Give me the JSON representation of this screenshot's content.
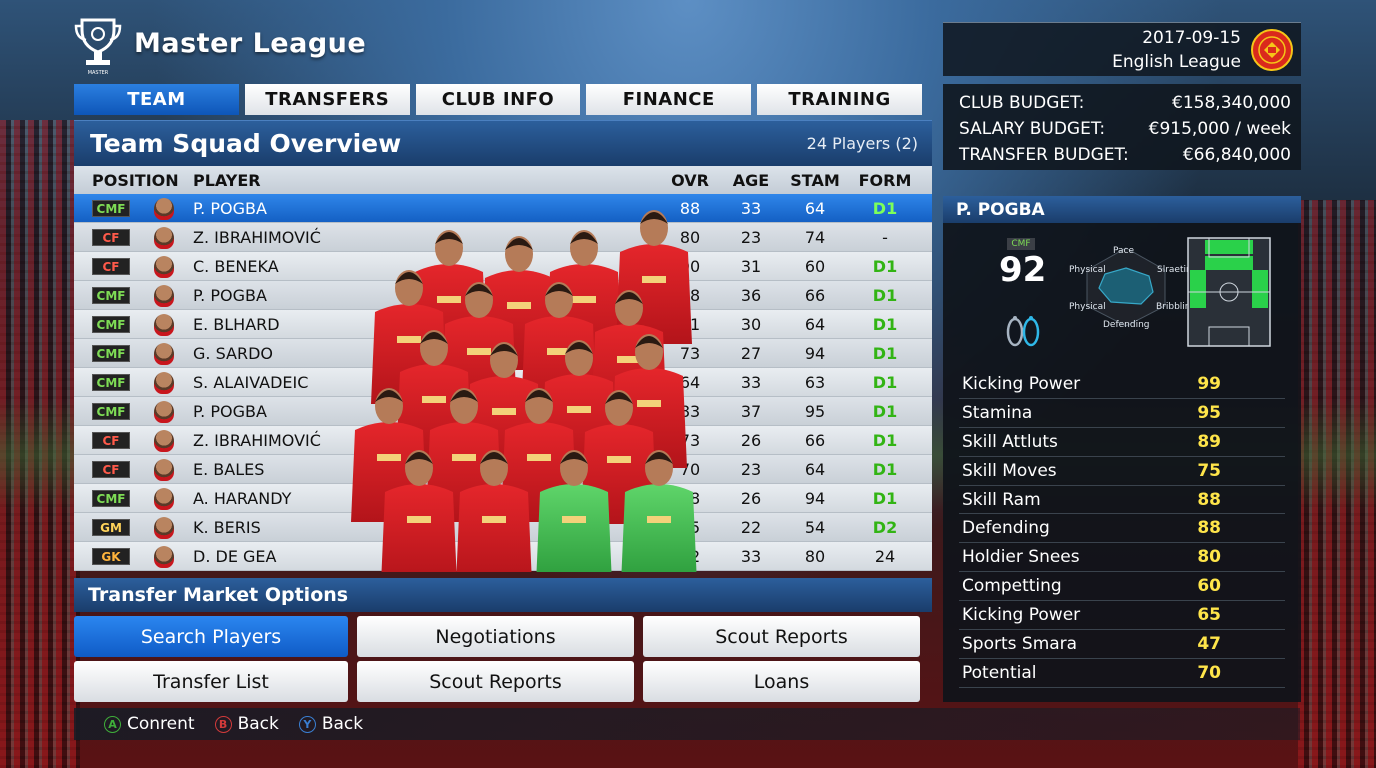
{
  "header": {
    "app_title": "Master League",
    "tabs": [
      "TEAM",
      "TRANSFERS",
      "CLUB INFO",
      "FINANCE",
      "TRAINING"
    ]
  },
  "club": {
    "date": "2017-09-15",
    "league": "English League"
  },
  "budget": [
    {
      "label": "CLUB BUDGET:",
      "value": "€158,340,000"
    },
    {
      "label": "SALARY BUDGET:",
      "value": "€915,000 / week"
    },
    {
      "label": "TRANSFER BUDGET:",
      "value": "€66,840,000"
    }
  ],
  "squad": {
    "title": "Team Squad Overview",
    "count": "24 Players (2)",
    "columns": {
      "position": "POSITION",
      "player": "PLAYER",
      "ovr": "OVR",
      "age": "AGE",
      "stam": "STAM",
      "form": "FORM"
    },
    "rows": [
      {
        "pos": "CMF",
        "name": "P. POGBA",
        "ovr": "88",
        "age": "33",
        "stam": "64",
        "form": "D1"
      },
      {
        "pos": "CF",
        "name": "Z. IBRAHIMOVIĆ",
        "ovr": "80",
        "age": "23",
        "stam": "74",
        "form": "-"
      },
      {
        "pos": "CF",
        "name": "C. BENEKA",
        "ovr": "90",
        "age": "31",
        "stam": "60",
        "form": "D1"
      },
      {
        "pos": "CMF",
        "name": "P. POGBA",
        "ovr": "88",
        "age": "36",
        "stam": "66",
        "form": "D1"
      },
      {
        "pos": "CMF",
        "name": "E. BLHARD",
        "ovr": "81",
        "age": "30",
        "stam": "64",
        "form": "D1"
      },
      {
        "pos": "CMF",
        "name": "G. SARDO",
        "ovr": "73",
        "age": "27",
        "stam": "94",
        "form": "D1"
      },
      {
        "pos": "CMF",
        "name": "S. ALAIVADEIC",
        "ovr": "64",
        "age": "33",
        "stam": "63",
        "form": "D1"
      },
      {
        "pos": "CMF",
        "name": "P. POGBA",
        "ovr": "83",
        "age": "37",
        "stam": "95",
        "form": "D1"
      },
      {
        "pos": "CF",
        "name": "Z. IBRAHIMOVIĆ",
        "ovr": "73",
        "age": "26",
        "stam": "66",
        "form": "D1"
      },
      {
        "pos": "CF",
        "name": "E. BALES",
        "ovr": "70",
        "age": "23",
        "stam": "64",
        "form": "D1"
      },
      {
        "pos": "CMF",
        "name": "A. HARANDY",
        "ovr": "78",
        "age": "26",
        "stam": "94",
        "form": "D1"
      },
      {
        "pos": "GM",
        "name": "K. BERIS",
        "ovr": "65",
        "age": "22",
        "stam": "54",
        "form": "D2"
      },
      {
        "pos": "GK",
        "name": "D. DE GEA",
        "ovr": "72",
        "age": "33",
        "stam": "80",
        "form": "24"
      }
    ]
  },
  "transfer_market": {
    "title": "Transfer Market Options",
    "buttons": [
      "Search Players",
      "Negotiations",
      "Scout Reports",
      "Transfer List",
      "Scout Reports",
      "Loans"
    ]
  },
  "footer": {
    "buttons": [
      {
        "glyph": "A",
        "label": "Conrent",
        "color": "#3fae3a"
      },
      {
        "glyph": "B",
        "label": "Back",
        "color": "#d23a3a"
      },
      {
        "glyph": "Y",
        "label": "Back",
        "color": "#3a7fd2"
      }
    ]
  },
  "player": {
    "name": "P. POGBA",
    "position": "CMF",
    "rating": "92",
    "radar_labels": [
      "Pace",
      "Physical",
      "Slraeting",
      "Physical",
      "Bribbling",
      "Defending"
    ],
    "stats": [
      {
        "label": "Kicking Power",
        "value": "99"
      },
      {
        "label": "Stamina",
        "value": "95"
      },
      {
        "label": "Skill Attluts",
        "value": "89"
      },
      {
        "label": "Skill Moves",
        "value": "75"
      },
      {
        "label": "Skill Ram",
        "value": "88"
      },
      {
        "label": "Defending",
        "value": "88"
      },
      {
        "label": "Holdier Snees",
        "value": "80"
      },
      {
        "label": "Competting",
        "value": "60"
      },
      {
        "label": "Kicking Power",
        "value": "65"
      },
      {
        "label": "Sports Smara",
        "value": "47"
      },
      {
        "label": "Potential",
        "value": "70"
      }
    ]
  },
  "colors": {
    "accent": "#1460c4",
    "form_good": "#32b414",
    "stat_value": "#ffe54a",
    "club_red": "#da291c"
  }
}
